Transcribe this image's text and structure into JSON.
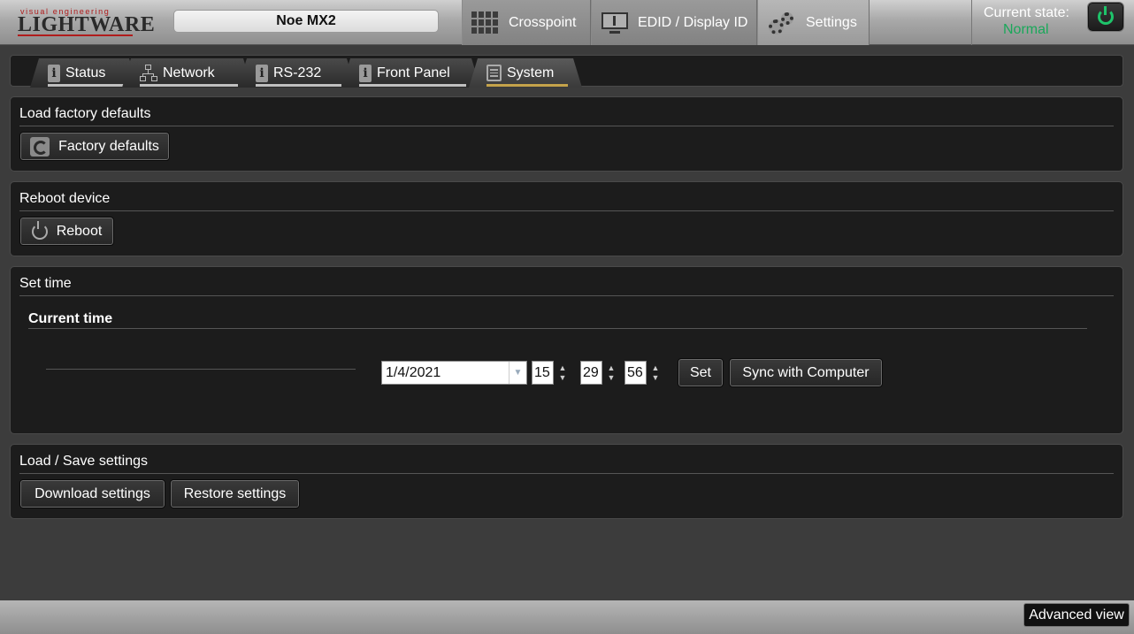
{
  "header": {
    "logo_small": "visual engineering",
    "logo_main": "LIGHTWARE",
    "device_name": "Noe MX2",
    "tabs": [
      {
        "label": "Crosspoint",
        "icon": "grid-icon"
      },
      {
        "label": "EDID / Display ID",
        "icon": "monitor-icon"
      },
      {
        "label": "Settings",
        "icon": "gears-icon",
        "active": true
      }
    ],
    "state_label": "Current state:",
    "state_value": "Normal",
    "state_color": "#1aa85a"
  },
  "subtabs": [
    {
      "label": "Status",
      "icon": "info-icon"
    },
    {
      "label": "Network",
      "icon": "network-icon"
    },
    {
      "label": "RS-232",
      "icon": "info-icon"
    },
    {
      "label": "Front Panel",
      "icon": "info-icon"
    },
    {
      "label": "System",
      "icon": "list-icon",
      "active": true
    }
  ],
  "sections": {
    "factory": {
      "title": "Load factory defaults",
      "button": "Factory defaults"
    },
    "reboot": {
      "title": "Reboot device",
      "button": "Reboot"
    },
    "time": {
      "title": "Set time",
      "subtitle": "Current time",
      "date": "1/4/2021",
      "hour": "15",
      "minute": "29",
      "second": "56",
      "set_button": "Set",
      "sync_button": "Sync with Computer"
    },
    "loadsave": {
      "title": "Load / Save settings",
      "download_button": "Download settings",
      "restore_button": "Restore settings"
    }
  },
  "footer": {
    "advanced_button": "Advanced view"
  },
  "colors": {
    "accent_underline": "#c4a24a",
    "power_green": "#1ec46a"
  }
}
